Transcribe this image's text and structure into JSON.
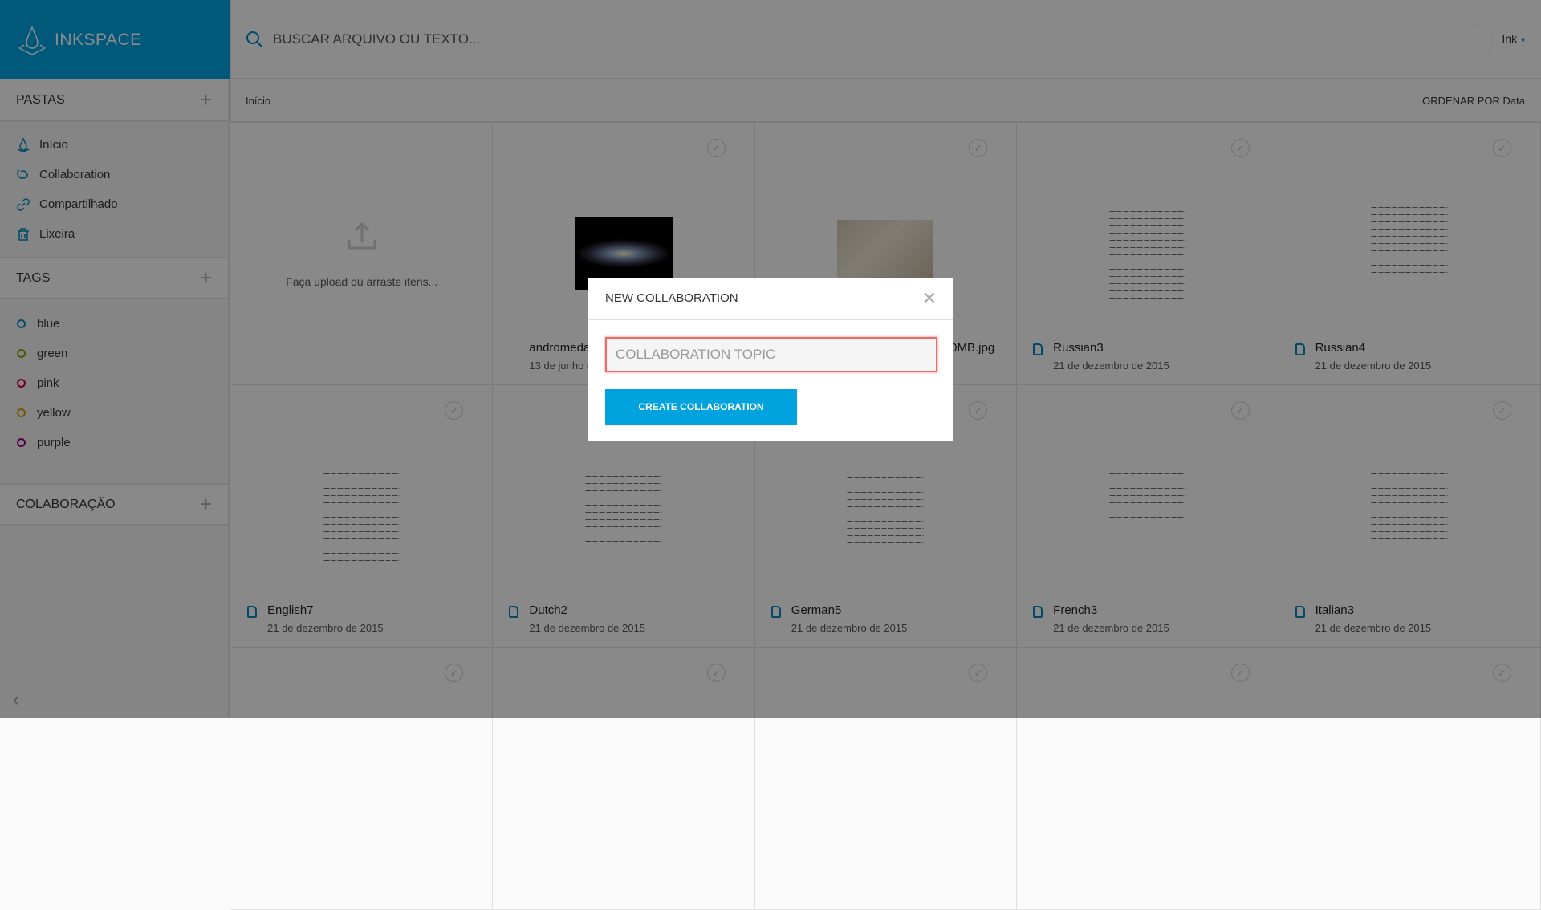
{
  "app": {
    "name": "INKSPACE",
    "brand_color": "#00a0e0"
  },
  "search": {
    "placeholder": "BUSCAR ARQUIVO OU TEXTO..."
  },
  "user": {
    "name": "Ink"
  },
  "breadcrumb": {
    "current": "Início",
    "sort_label": "ORDENAR POR Data"
  },
  "sidebar": {
    "folders_title": "PASTAS",
    "folders": [
      {
        "label": "Início",
        "icon": "ink-drop-icon"
      },
      {
        "label": "Collaboration",
        "icon": "collaboration-icon"
      },
      {
        "label": "Compartilhado",
        "icon": "link-icon"
      },
      {
        "label": "Lixeira",
        "icon": "trash-icon"
      }
    ],
    "tags_title": "TAGS",
    "tags": [
      {
        "label": "blue",
        "color": "#0a8fc0"
      },
      {
        "label": "green",
        "color": "#8aa000"
      },
      {
        "label": "pink",
        "color": "#c0004f"
      },
      {
        "label": "yellow",
        "color": "#d6a000"
      },
      {
        "label": "purple",
        "color": "#9a0080"
      }
    ],
    "collab_title": "COLABORAÇÃO"
  },
  "grid": {
    "upload_text": "Faça upload ou arraste itens...",
    "cards": [
      {
        "name": "andromeda",
        "date": "13 de junho d"
      },
      {
        "name": "0MB.jpg",
        "date": ""
      },
      {
        "name": "Russian3",
        "date": "21 de dezembro de 2015"
      },
      {
        "name": "Russian4",
        "date": "21 de dezembro de 2015"
      },
      {
        "name": "English7",
        "date": "21 de dezembro de 2015"
      },
      {
        "name": "Dutch2",
        "date": "21 de dezembro de 2015"
      },
      {
        "name": "German5",
        "date": "21 de dezembro de 2015"
      },
      {
        "name": "French3",
        "date": "21 de dezembro de 2015"
      },
      {
        "name": "Italian3",
        "date": "21 de dezembro de 2015"
      }
    ]
  },
  "modal": {
    "title": "NEW COLLABORATION",
    "topic_placeholder": "COLLABORATION TOPIC",
    "topic_value": "",
    "create_label": "CREATE COLLABORATION",
    "input_error_color": "#f06a6a",
    "button_color": "#00a3de"
  }
}
